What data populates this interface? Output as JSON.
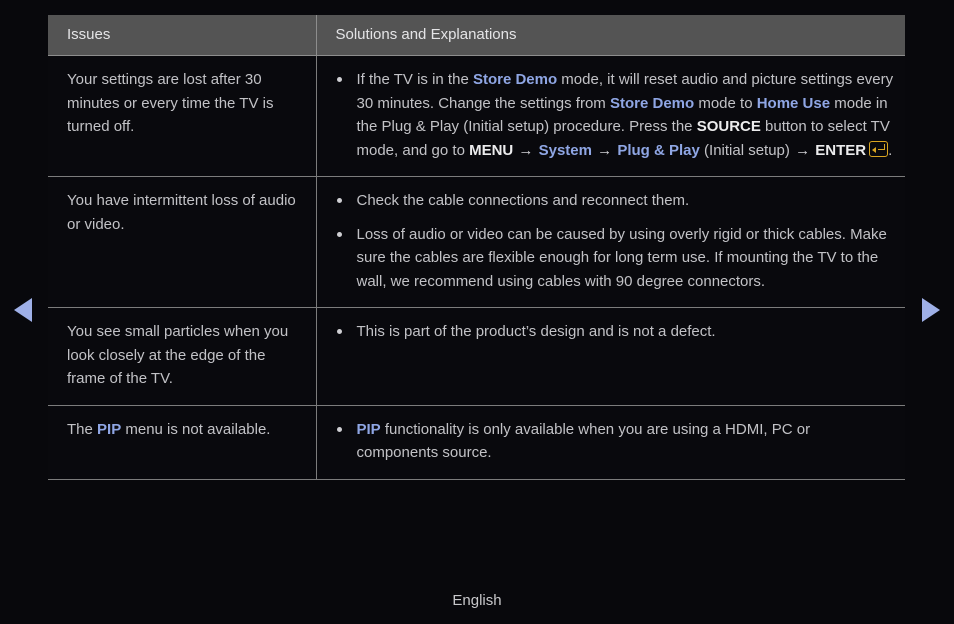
{
  "page": {
    "footer_language": "English",
    "background_color": "#08080c",
    "accent_blue": "#8fa6e4",
    "key_gold": "#d9a521",
    "arrow_color": "#9fb0e8"
  },
  "nav": {
    "prev_label": "Previous page",
    "next_label": "Next page"
  },
  "table": {
    "headers": {
      "issues": "Issues",
      "solutions": "Solutions and Explanations"
    },
    "rows": [
      {
        "issue": {
          "parts": [
            {
              "text": "Your settings are lost after 30 minutes or every time the TV is turned off.",
              "style": "plain"
            }
          ]
        },
        "bullets": [
          {
            "parts": [
              {
                "text": "If the TV is in the ",
                "style": "plain"
              },
              {
                "text": "Store Demo",
                "style": "blue-bold"
              },
              {
                "text": " mode, it will reset audio and picture settings every 30 minutes. Change the settings from ",
                "style": "plain"
              },
              {
                "text": "Store Demo",
                "style": "blue-bold"
              },
              {
                "text": " mode to ",
                "style": "plain"
              },
              {
                "text": "Home Use",
                "style": "blue-bold"
              },
              {
                "text": " mode in the Plug & Play (Initial setup) procedure. Press the ",
                "style": "plain"
              },
              {
                "text": "SOURCE",
                "style": "white-bold"
              },
              {
                "text": " button to select TV mode, and go to ",
                "style": "plain"
              },
              {
                "text": "MENU",
                "style": "white-bold"
              },
              {
                "text": " → ",
                "style": "arrow"
              },
              {
                "text": "System",
                "style": "blue-bold"
              },
              {
                "text": " → ",
                "style": "arrow"
              },
              {
                "text": "Plug & Play",
                "style": "blue-bold"
              },
              {
                "text": " (Initial setup)",
                "style": "plain"
              },
              {
                "text": " → ",
                "style": "arrow"
              },
              {
                "text": "ENTER",
                "style": "white-bold"
              },
              {
                "text": "enter-key-icon",
                "style": "enter-icon"
              },
              {
                "text": ".",
                "style": "plain"
              }
            ]
          }
        ]
      },
      {
        "issue": {
          "parts": [
            {
              "text": "You have intermittent loss of audio or video.",
              "style": "plain"
            }
          ]
        },
        "bullets": [
          {
            "parts": [
              {
                "text": "Check the cable connections and reconnect them.",
                "style": "plain"
              }
            ]
          },
          {
            "parts": [
              {
                "text": "Loss of audio or video can be caused by using overly rigid or thick cables. Make sure the cables are flexible enough for long term use. If mounting the TV to the wall, we recommend using cables with 90 degree connectors.",
                "style": "plain"
              }
            ]
          }
        ]
      },
      {
        "issue": {
          "parts": [
            {
              "text": "You see small particles when you look closely at the edge of the frame of the TV.",
              "style": "plain"
            }
          ]
        },
        "bullets": [
          {
            "parts": [
              {
                "text": "This is part of the product’s design and is not a defect.",
                "style": "plain"
              }
            ]
          }
        ]
      },
      {
        "issue": {
          "parts": [
            {
              "text": "The ",
              "style": "plain"
            },
            {
              "text": "PIP",
              "style": "blue-bold"
            },
            {
              "text": " menu is not available.",
              "style": "plain"
            }
          ]
        },
        "bullets": [
          {
            "parts": [
              {
                "text": "PIP",
                "style": "blue-bold"
              },
              {
                "text": " functionality is only available when you are using a HDMI, PC or components source.",
                "style": "plain"
              }
            ]
          }
        ]
      }
    ]
  }
}
